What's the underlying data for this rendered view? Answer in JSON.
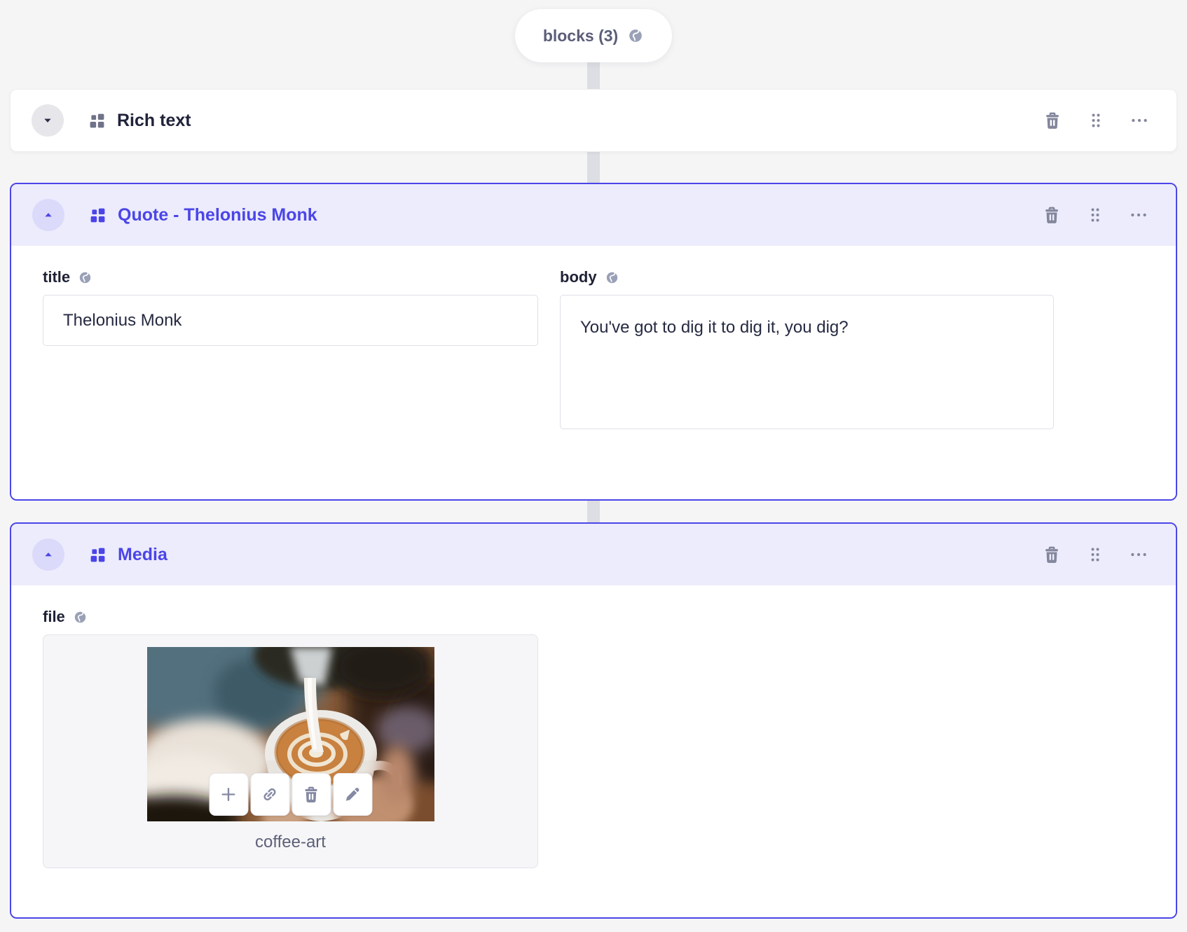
{
  "colors": {
    "accent": "#4b45e8",
    "page_background": "#f5f5f6",
    "selected_header_background": "#ececfc",
    "connector": "#dcdee3",
    "icon_gray": "#83869c",
    "globe_icon": "#9aa0b6"
  },
  "pill": {
    "label": "blocks (3)",
    "icon": "globe"
  },
  "icons": {
    "collapse_open": "chevron-up",
    "collapse_closed": "chevron-down",
    "block_type": "blocks-grid",
    "row_actions": [
      "trash",
      "drag-dots",
      "ellipsis"
    ],
    "upload_actions": [
      "plus",
      "link",
      "trash",
      "pen"
    ],
    "localized_field": "globe"
  },
  "blocks": [
    {
      "title": "Rich text",
      "state": "collapsed",
      "selected": false
    },
    {
      "title": "Quote - Thelonius Monk",
      "state": "expanded",
      "selected": true,
      "fields": [
        {
          "label": "title",
          "localized": true,
          "type": "text",
          "value": "Thelonius Monk"
        },
        {
          "label": "body",
          "localized": true,
          "type": "textarea",
          "value": "You've got to dig it to dig it, you dig?"
        }
      ]
    },
    {
      "title": "Media",
      "state": "expanded",
      "selected": true,
      "fields": [
        {
          "label": "file",
          "localized": true,
          "type": "upload",
          "filename": "coffee-art"
        }
      ]
    }
  ]
}
